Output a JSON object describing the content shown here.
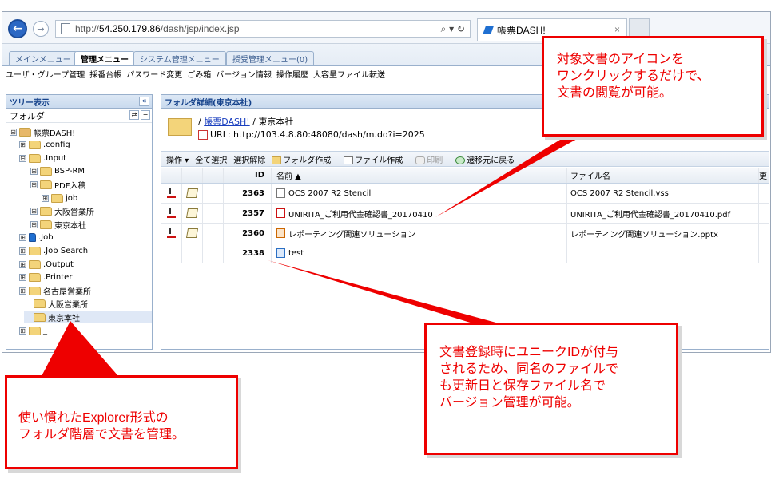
{
  "browser": {
    "url_prefix": "http://",
    "url_host": "54.250.179.86",
    "url_path": "/dash/jsp/index.jsp",
    "url_tools": "⌕ ▾ ↻",
    "tab_title": "帳票DASH!",
    "tab_close": "×"
  },
  "menu": {
    "tabs": [
      "メインメニュー",
      "管理メニュー",
      "システム管理メニュー",
      "授受管理メニュー(0)"
    ],
    "submenu": [
      "ユーザ・グループ管理",
      "採番台帳",
      "パスワード変更",
      "ごみ箱",
      "バージョン情報",
      "操作履歴",
      "大容量ファイル転送"
    ]
  },
  "tree": {
    "header": "ツリー表示",
    "collapse": "«",
    "subheader": "フォルダ",
    "nodes": [
      {
        "label": "帳票DASH!",
        "pm": "⊟"
      },
      {
        "label": ".config",
        "pm": "⊞"
      },
      {
        "label": ".Input",
        "pm": "⊟"
      },
      {
        "label": "BSP-RM",
        "pm": "⊞"
      },
      {
        "label": "PDF入稿",
        "pm": "⊟"
      },
      {
        "label": "job",
        "pm": "⊞"
      },
      {
        "label": "大阪営業所",
        "pm": "⊞"
      },
      {
        "label": "東京本社",
        "pm": "⊞"
      },
      {
        "label": ".Job",
        "pm": "⊞"
      },
      {
        "label": ".Job Search",
        "pm": "⊞"
      },
      {
        "label": ".Output",
        "pm": "⊞"
      },
      {
        "label": ".Printer",
        "pm": "⊞"
      },
      {
        "label": "名古屋営業所",
        "pm": "⊞"
      },
      {
        "label": "大阪営業所",
        "pm": ""
      },
      {
        "label": "東京本社",
        "pm": ""
      },
      {
        "label": "_",
        "pm": "⊞"
      }
    ]
  },
  "detail": {
    "header": "フォルダ詳細(東京本社)",
    "path_prefix": "/ ",
    "path_link": "帳票DASH!",
    "path_rest": " / 東京本社",
    "url_label": "URL:  http://103.4.8.80:48080/dash/m.do?i=2025"
  },
  "toolbar": [
    "操作 ▾",
    "全て選択",
    "選択解除",
    "フォルダ作成",
    "ファイル作成",
    "印刷",
    "遷移元に戻る"
  ],
  "grid": {
    "columns": {
      "id": "ID",
      "name": "名前 ▲",
      "file": "ファイル名",
      "extra": "更"
    },
    "rows": [
      {
        "id": "2363",
        "name": "OCS 2007 R2 Stencil",
        "file": "OCS 2007 R2 Stencil.vss",
        "icon": "doc-icon"
      },
      {
        "id": "2357",
        "name": "UNIRITA_ご利用代金確認書_20170410",
        "file": "UNIRITA_ご利用代金確認書_20170410.pdf",
        "icon": "pdf-icon"
      },
      {
        "id": "2360",
        "name": "レポーティング関連ソリューション",
        "file": "レポーティング関連ソリューション.pptx",
        "icon": "pptx-icon"
      },
      {
        "id": "2338",
        "name": "test",
        "file": "",
        "icon": "link-icon"
      }
    ]
  },
  "callouts": {
    "top": "対象文書のアイコンを\nワンクリックするだけで、\n文書の閲覧が可能。",
    "mid": "文書登録時にユニークIDが付与\nされるため、同名のファイルで\nも更新日と保存ファイル名で\nバージョン管理が可能。",
    "left": "使い慣れたExplorer形式の\nフォルダ階層で文書を管理。"
  },
  "colors": {
    "callout": "#e00000",
    "header_text": "#15428b",
    "link": "#1a3fbf"
  }
}
